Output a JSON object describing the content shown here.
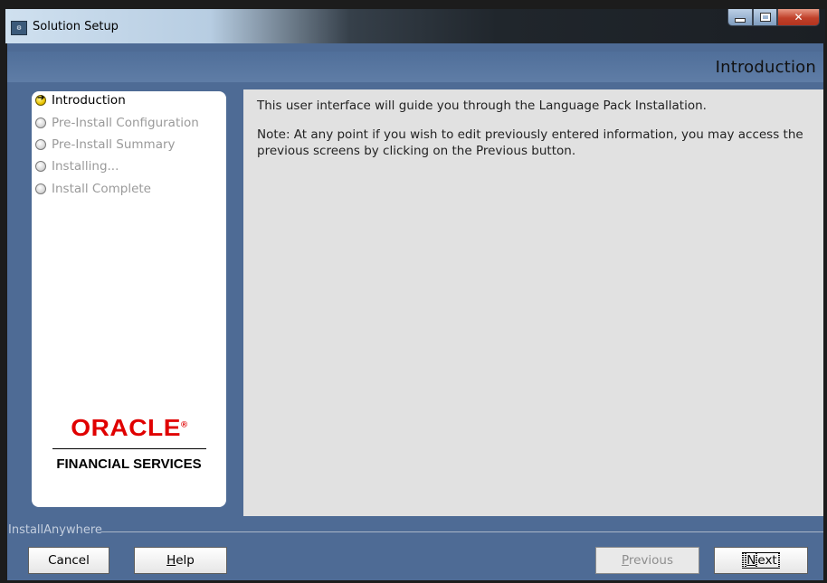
{
  "window": {
    "title": "Solution Setup",
    "app_icon": "installer-icon",
    "controls": {
      "minimize": "minimize-icon",
      "maximize": "maximize-icon",
      "close": "✕"
    }
  },
  "header": {
    "step_title": "Introduction"
  },
  "steps": [
    {
      "label": "Introduction",
      "state": "current"
    },
    {
      "label": "Pre-Install Configuration",
      "state": "pending"
    },
    {
      "label": "Pre-Install Summary",
      "state": "pending"
    },
    {
      "label": "Installing...",
      "state": "pending"
    },
    {
      "label": "Install Complete",
      "state": "pending"
    }
  ],
  "logo": {
    "brand": "ORACLE",
    "trademark": "®",
    "subtitle": "FINANCIAL SERVICES"
  },
  "content": {
    "intro": "This user interface will guide you through the Language Pack Installation.",
    "note": "Note: At any point if you wish to edit previously entered information, you may access the previous screens by clicking on the Previous button."
  },
  "footer": {
    "installer_label": "InstallAnywhere",
    "buttons": {
      "cancel": "Cancel",
      "help_prefix": "",
      "help_mnemonic": "H",
      "help_rest": "elp",
      "previous_prefix": "",
      "previous_mnemonic": "P",
      "previous_rest": "revious",
      "next_prefix": "",
      "next_mnemonic": "N",
      "next_rest": "ext"
    }
  },
  "colors": {
    "client_bg": "#4e6b95",
    "content_bg": "#e1e1e1",
    "brand_red": "#e00000",
    "active_step_bullet": "#e9c300"
  }
}
